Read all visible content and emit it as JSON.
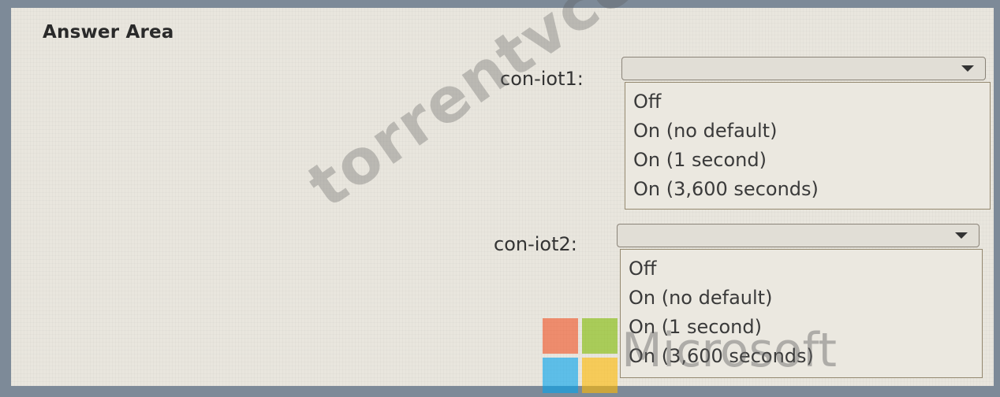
{
  "title": "Answer Area",
  "dropdowns": [
    {
      "label": "con-iot1:",
      "selected": "",
      "options": [
        "Off",
        "On (no default)",
        "On (1 second)",
        "On (3,600 seconds)"
      ]
    },
    {
      "label": "con-iot2:",
      "selected": "",
      "options": [
        "Off",
        "On (no default)",
        "On (1 second)",
        "On (3,600 seconds)"
      ]
    }
  ],
  "watermark": {
    "text": "torrentvce.com",
    "logo_text": "Microsoft",
    "logo_colors": [
      "#f25022",
      "#7fba00",
      "#00a4ef",
      "#ffb900"
    ]
  }
}
